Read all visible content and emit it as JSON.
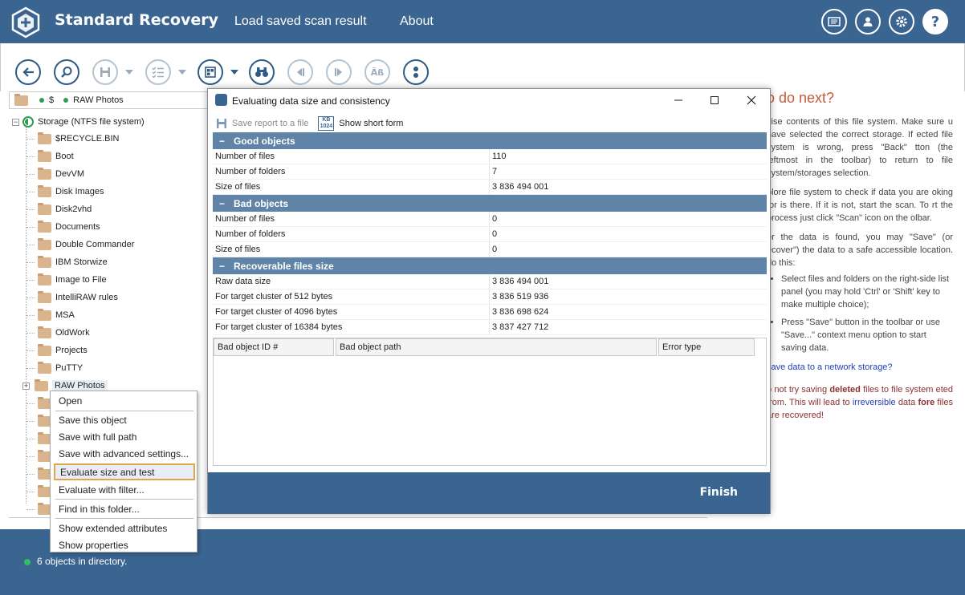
{
  "header": {
    "app_title": "Standard Recovery",
    "nav": [
      "Load saved scan result",
      "About"
    ]
  },
  "pathbar": {
    "root": "$",
    "folder": "RAW Photos"
  },
  "tree": {
    "storage_label": "Storage (NTFS file system)",
    "folders": [
      "$RECYCLE.BIN",
      "Boot",
      "DevVM",
      "Disk Images",
      "Disk2vhd",
      "Documents",
      "Double Commander",
      "IBM Storwize",
      "Image to File",
      "IntelliRAW rules",
      "MSA",
      "OldWork",
      "Projects",
      "PuTTY",
      "RAW Photos"
    ]
  },
  "context_menu": {
    "items": [
      "Open",
      "Save this object",
      "Save with full path",
      "Save with advanced settings...",
      "Evaluate size and test",
      "Evaluate with filter...",
      "Find in this folder...",
      "Show extended attributes",
      "Show properties"
    ]
  },
  "help": {
    "title": "o do next?",
    "p1": "vise contents of this file system. Make sure u have selected the correct storage. If ected file system is wrong, press \"Back\" tton (the leftmost in the toolbar) to return to file system/storages selection.",
    "p2": "plore file system to check if data you are oking for is there. If it is not, start the scan. To rt the process just click \"Scan\" icon on the olbar.",
    "p3": "er the data is found, you may \"Save\" (or ecover\") the data to a safe accessible location. do this:",
    "bullet1": "Select files and folders on the right-side list panel (you may hold 'Ctrl' or 'Shift' key to make multiple choice);",
    "bullet2": "Press \"Save\" button in the toolbar or use \"Save...\" context menu option to start saving data.",
    "link": "save data to a network storage?",
    "warn_a": "o not try saving ",
    "warn_b": "deleted",
    "warn_c": " files to file system eted from. This will lead to ",
    "warn_d": "irreversible",
    "warn_e": " data ",
    "warn_f": "fore",
    "warn_g": " files are recovered!"
  },
  "status": {
    "text": "6 objects in directory."
  },
  "dialog": {
    "title": "Evaluating data size and consistency",
    "save_report": "Save report to a file",
    "kb_badge_top": "KB",
    "kb_badge_bottom": "1024",
    "short_form": "Show short form",
    "sections": [
      {
        "title": "Good objects",
        "rows": [
          {
            "label": "Number of files",
            "value": "110"
          },
          {
            "label": "Number of folders",
            "value": "7"
          },
          {
            "label": "Size of files",
            "value": "3 836 494 001"
          }
        ]
      },
      {
        "title": "Bad objects",
        "rows": [
          {
            "label": "Number of files",
            "value": "0"
          },
          {
            "label": "Number of folders",
            "value": "0"
          },
          {
            "label": "Size of files",
            "value": "0"
          }
        ]
      },
      {
        "title": "Recoverable files size",
        "rows": [
          {
            "label": "Raw data size",
            "value": "3 836 494 001"
          },
          {
            "label": "For target cluster of 512 bytes",
            "value": "3 836 519 936"
          },
          {
            "label": "For target cluster of 4096 bytes",
            "value": "3 836 698 624"
          },
          {
            "label": "For target cluster of 16384 bytes",
            "value": "3 837 427 712"
          }
        ]
      }
    ],
    "error_columns": [
      "Bad object ID #",
      "Bad object path",
      "Error type"
    ],
    "finish": "Finish"
  }
}
